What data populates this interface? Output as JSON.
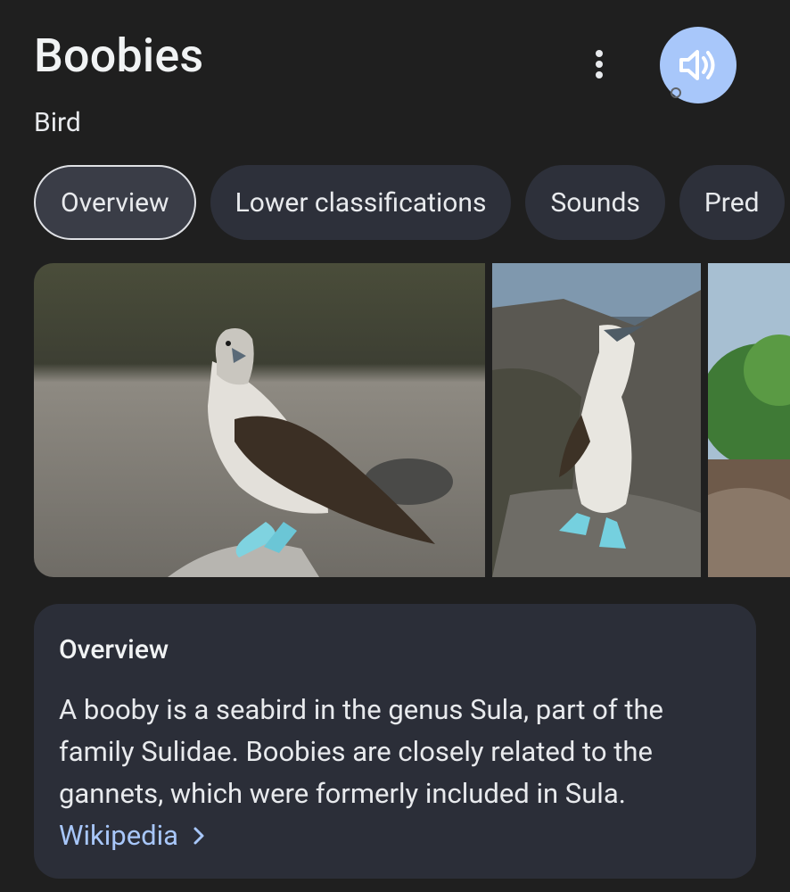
{
  "header": {
    "title": "Boobies",
    "subtitle": "Bird",
    "more_icon": "more-vert-icon",
    "speaker_icon": "volume-icon"
  },
  "tabs": [
    {
      "label": "Overview",
      "active": true
    },
    {
      "label": "Lower classifications",
      "active": false
    },
    {
      "label": "Sounds",
      "active": false
    },
    {
      "label": "Pred",
      "active": false
    }
  ],
  "images": [
    {
      "alt": "Blue-footed booby on rock"
    },
    {
      "alt": "Blue-footed booby standing"
    },
    {
      "alt": "Coastal vegetation"
    }
  ],
  "overview": {
    "heading": "Overview",
    "text": "A booby is a seabird in the genus Sula, part of the family Sulidae. Boobies are closely related to the gannets, which were formerly included in Sula.",
    "source_label": "Wikipedia"
  },
  "colors": {
    "background": "#1f1f1f",
    "chip": "#2d303a",
    "card": "#2b2e38",
    "accent": "#a8c7fa"
  }
}
